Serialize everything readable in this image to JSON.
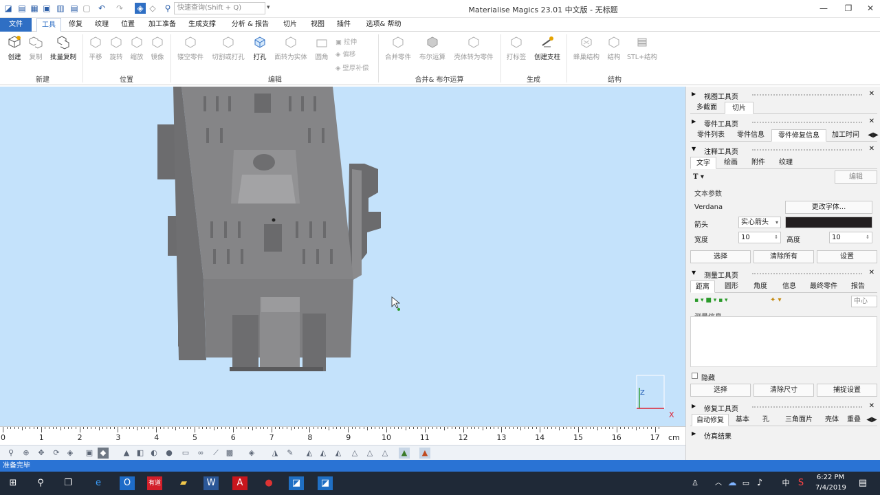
{
  "window": {
    "title": "Materialise Magics 23.01 中文版 - 无标题",
    "search_placeholder": "快速查询(Shift + Q)"
  },
  "menu": {
    "file": "文件",
    "tools": "工具",
    "repair": "修复",
    "texture": "纹理",
    "position": "位置",
    "machining": "加工准备",
    "support": "生成支撑",
    "analysis": "分析 & 报告",
    "slice": "切片",
    "view": "视图",
    "plugins": "插件",
    "options": "选项& 帮助"
  },
  "ribbon": {
    "new": {
      "create": "创建",
      "copy": "复制",
      "batch_copy": "批量复制",
      "group": "新建"
    },
    "position": {
      "translate": "平移",
      "rotate": "旋转",
      "scale": "缩放",
      "mirror": "镜像",
      "group": "位置"
    },
    "edit": {
      "hollow": "镂空零件",
      "cut": "切割或打孔",
      "punch": "打孔",
      "shell_to_solid": "面转为实体",
      "fillet": "圆角",
      "extrude": "拉伸",
      "offset": "偏移",
      "wall_thickness": "壁厚补偿",
      "group": "编辑"
    },
    "merge": {
      "merge": "合并零件",
      "boolean": "布尔运算",
      "shell_to_part": "壳体转为零件",
      "group": "合并& 布尔运算"
    },
    "generate": {
      "label": "打标签",
      "create_support": "创建支柱",
      "group": "生成"
    },
    "structure": {
      "lattice": "蜂巢结构",
      "structure": "结构",
      "stl_structure": "STL+结构",
      "group": "结构"
    }
  },
  "ruler": {
    "unit": "cm",
    "labels": [
      "0",
      "1",
      "2",
      "3",
      "4",
      "5",
      "6",
      "7",
      "8",
      "9",
      "10",
      "11",
      "12",
      "13",
      "14",
      "15",
      "16",
      "17"
    ]
  },
  "status": "准备完毕",
  "taskbar": {
    "time": "6:22 PM",
    "date": "7/4/2019",
    "ime": "中"
  },
  "panel": {
    "view_page": {
      "title": "视图工具页",
      "tabs": [
        "多截面",
        "切片"
      ]
    },
    "part_page": {
      "title": "零件工具页",
      "tabs": [
        "零件列表",
        "零件信息",
        "零件修复信息",
        "加工时间"
      ]
    },
    "annot_page": {
      "title": "注释工具页",
      "tabs": [
        "文字",
        "绘画",
        "附件",
        "纹理"
      ],
      "edit": "编辑",
      "text_params": "文本参数",
      "font": "Verdana",
      "change_font": "更改字体...",
      "arrow_label": "箭头",
      "arrow_value": "实心箭头",
      "width_label": "宽度",
      "width_value": "10",
      "height_label": "高度",
      "height_value": "10",
      "select": "选择",
      "clear_all": "清除所有",
      "settings": "设置"
    },
    "measure_page": {
      "title": "测量工具页",
      "tabs": [
        "距离",
        "圆形",
        "角度",
        "信息",
        "最终零件",
        "报告"
      ],
      "center": "中心",
      "info_label": "测量信息",
      "hide": "隐藏",
      "select": "选择",
      "clear_dims": "清除尺寸",
      "snap": "捕捉设置"
    },
    "repair_page": {
      "title": "修复工具页",
      "tabs": [
        "自动修复",
        "基本",
        "孔",
        "三角面片",
        "壳体",
        "重叠"
      ]
    },
    "sim_page": {
      "title": "仿真结果"
    }
  },
  "colors": {
    "accent": "#2f6fc4",
    "viewport": "#c4e2fb",
    "part": "#7b7b7d",
    "arrow_swatch": "#231f20"
  }
}
